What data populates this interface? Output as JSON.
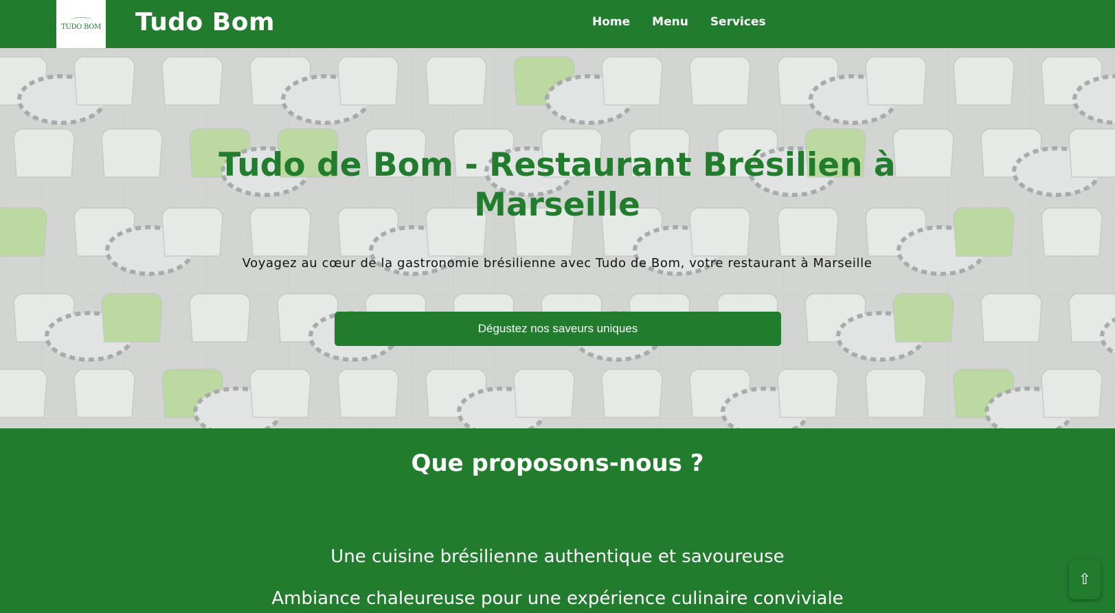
{
  "header": {
    "logo_text": "TUDO BOM",
    "brand": "Tudo Bom",
    "nav": [
      "Home",
      "Menu",
      "Services"
    ]
  },
  "hero": {
    "title": "Tudo de Bom - Restaurant Brésilien à Marseille",
    "subtitle": "Voyagez au cœur de la gastronomie brésilienne avec Tudo de Bom, votre restaurant à Marseille",
    "cta_label": "Dégustez nos saveurs uniques"
  },
  "offer": {
    "title": "Que proposons-nous ?",
    "items": [
      "Une cuisine brésilienne authentique et savoureuse",
      "Ambiance chaleureuse pour une expérience culinaire conviviale"
    ]
  },
  "scroll_top_icon": "⇧",
  "colors": {
    "brand_green": "#217c2e",
    "white": "#ffffff"
  }
}
